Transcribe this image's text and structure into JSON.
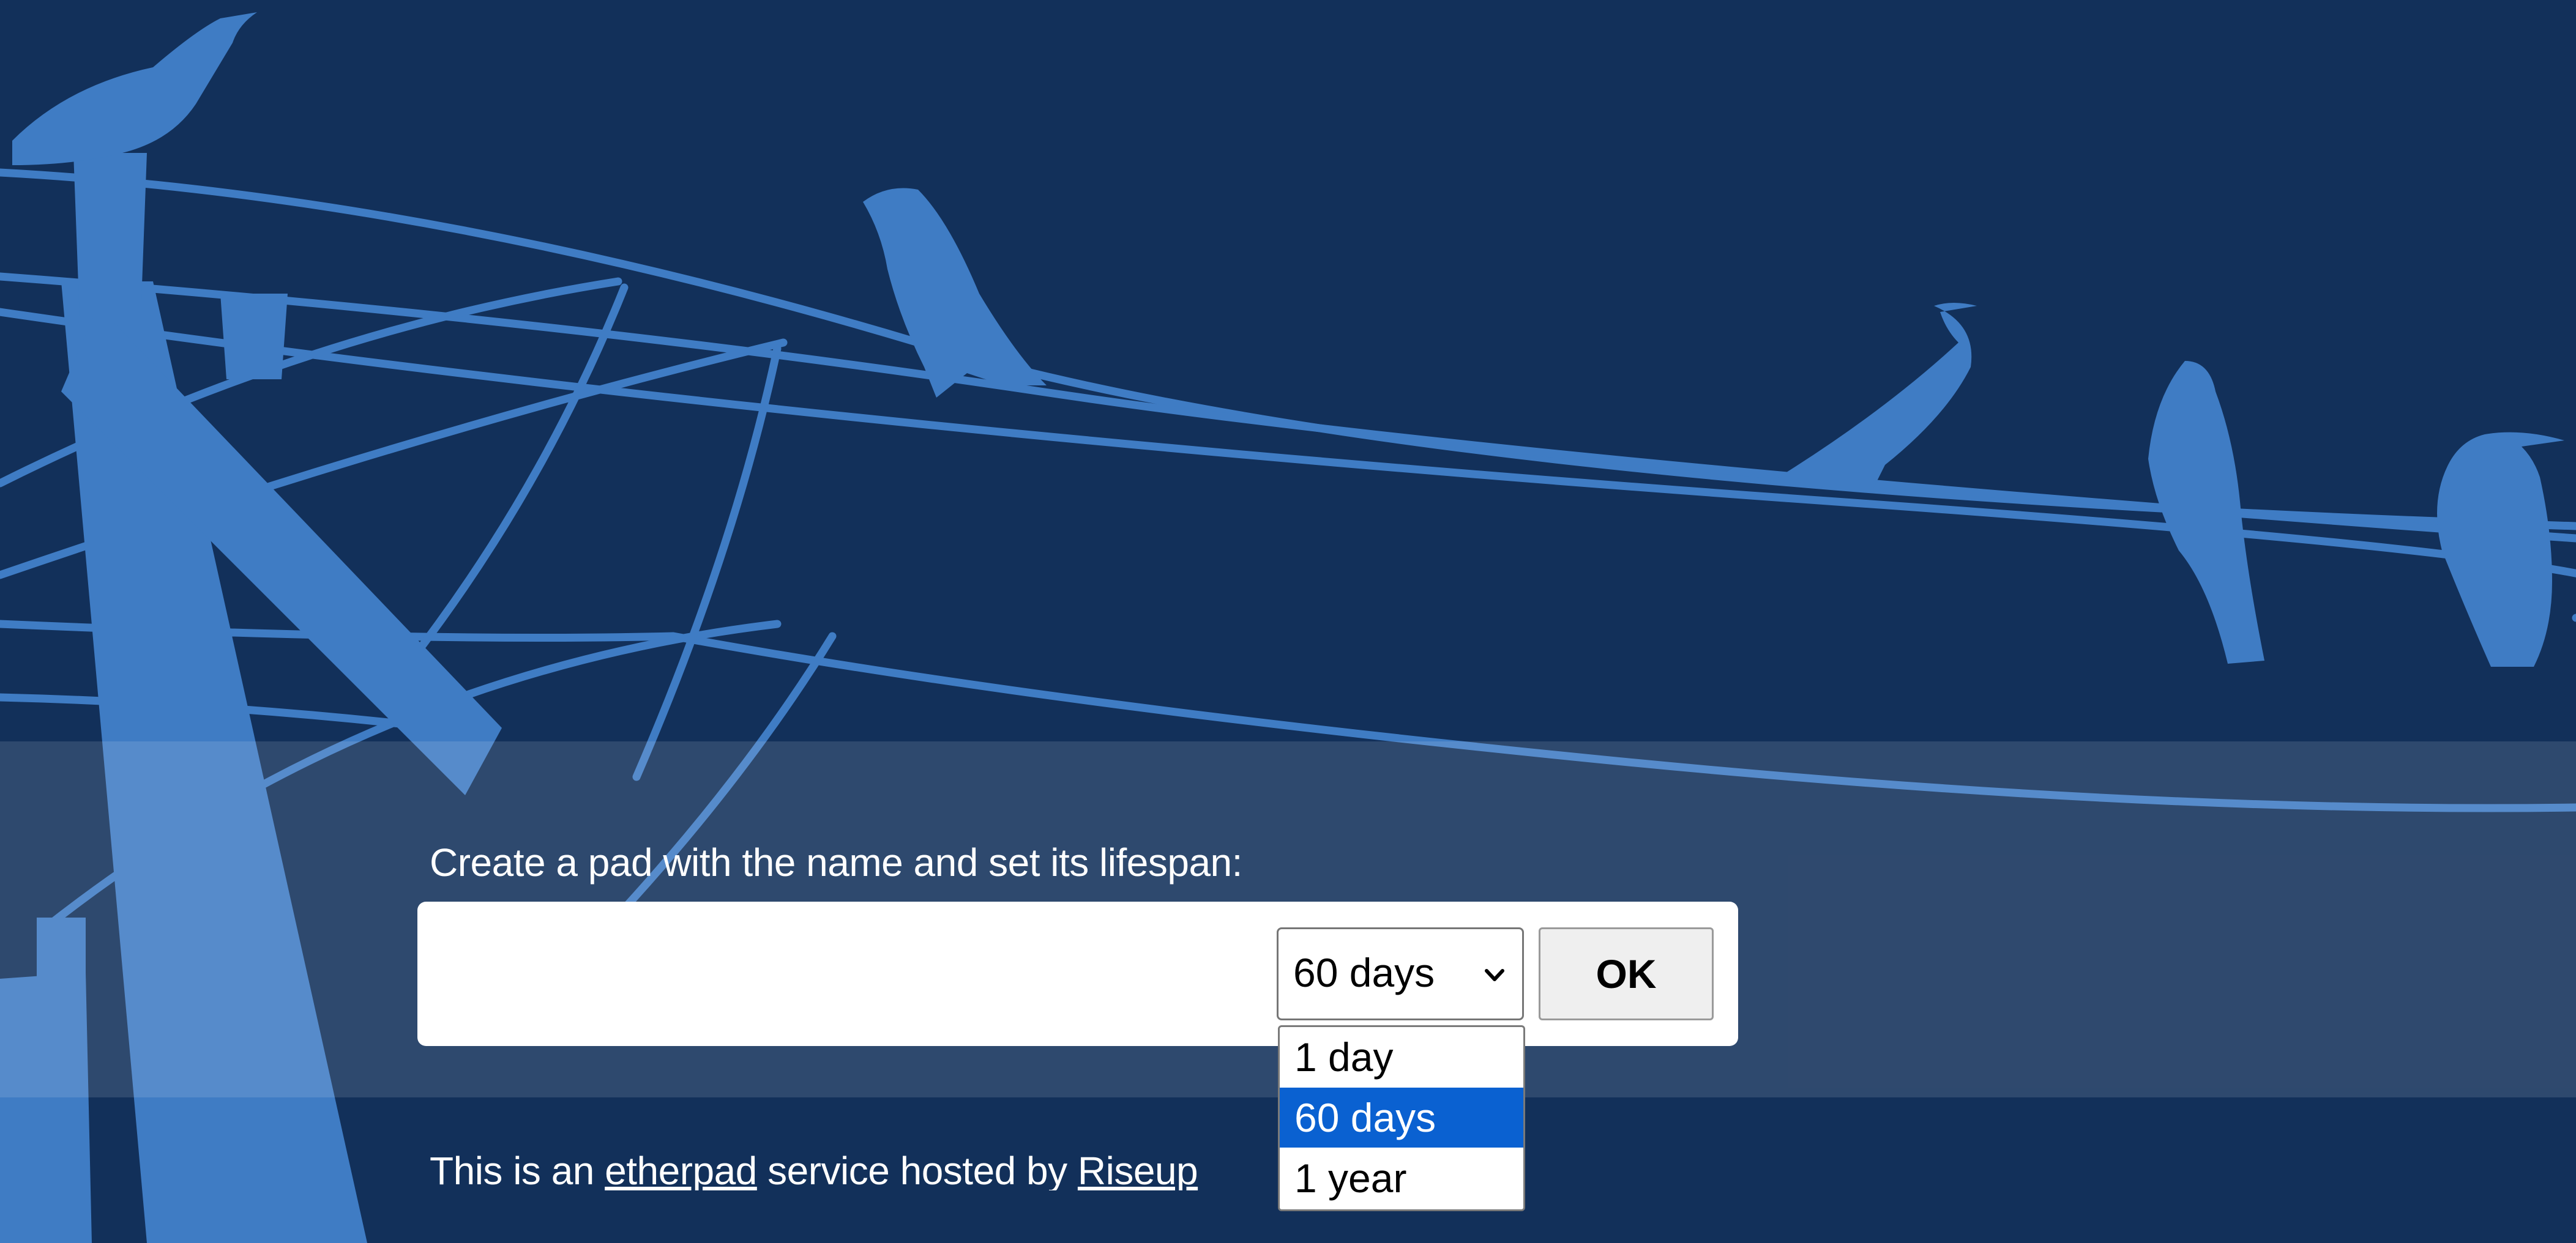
{
  "prompt": {
    "text": "Create a pad with the name and set its lifespan:"
  },
  "form": {
    "pad_name_value": "",
    "lifespan_selected": "60 days",
    "lifespan_options": [
      "1 day",
      "60 days",
      "1 year"
    ],
    "ok_label": "OK"
  },
  "footer": {
    "prefix": "This is an ",
    "etherpad_link": "etherpad",
    "middle": " service hosted by ",
    "host_link": "Riseup"
  },
  "icons": {
    "select_chevron": "chevron-down-icon"
  },
  "colors": {
    "background": "#12305a",
    "silhouette": "#3f7cc4",
    "option_highlight": "#0a61d1"
  }
}
